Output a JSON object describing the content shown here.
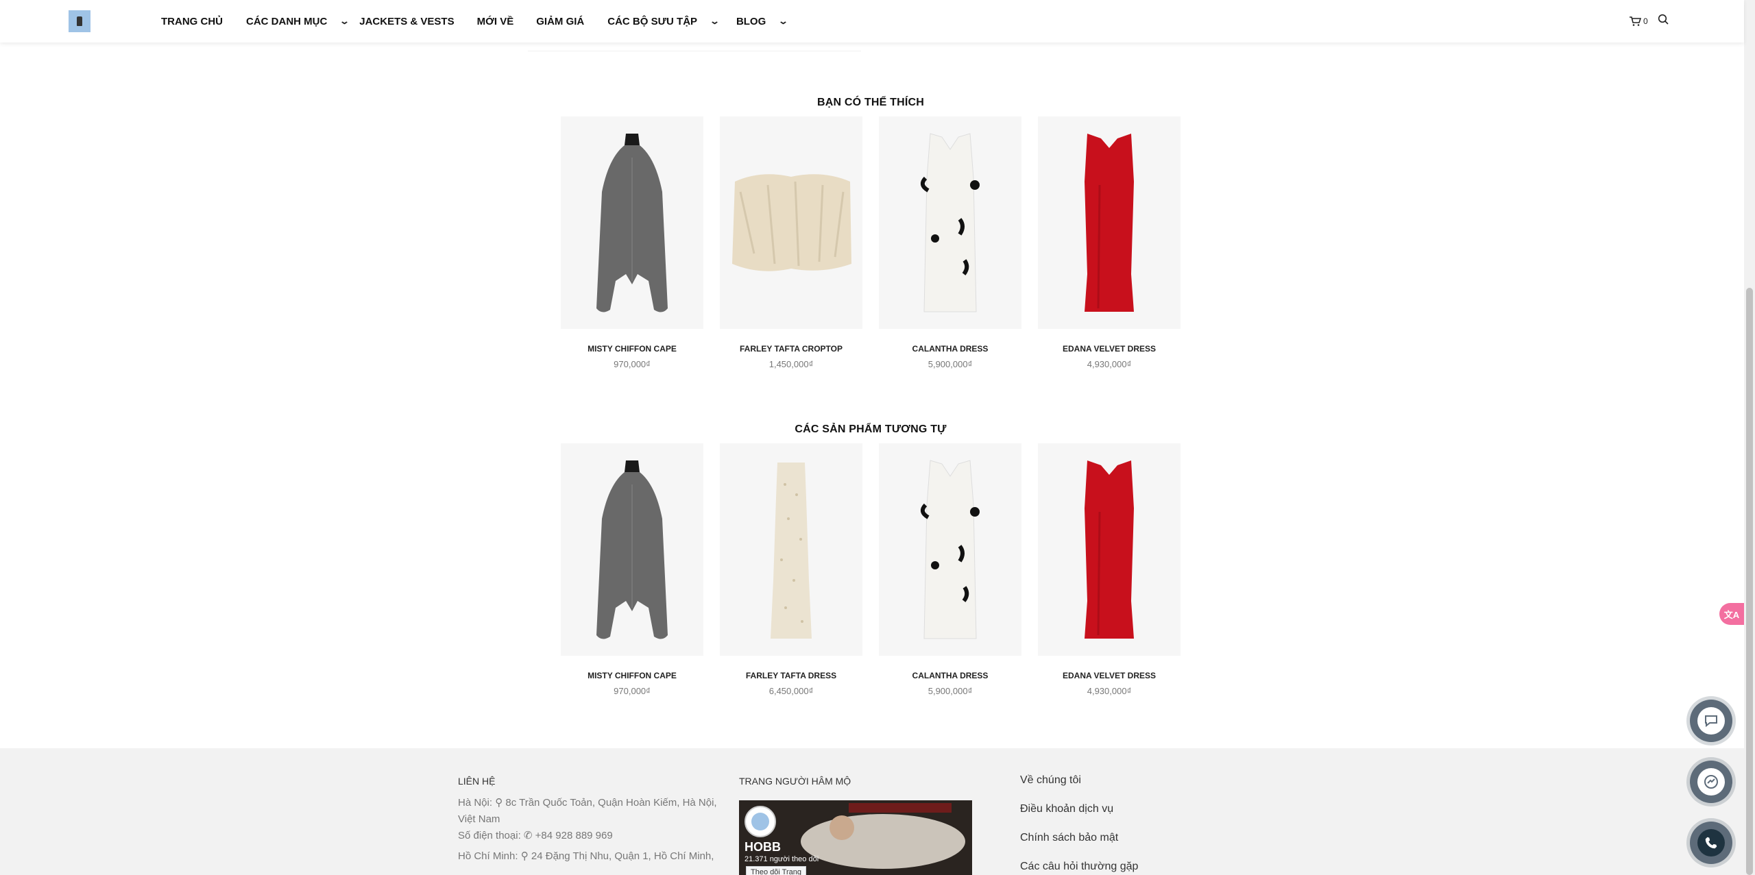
{
  "header": {
    "nav": [
      {
        "label": "TRANG CHỦ",
        "has_dropdown": false
      },
      {
        "label": "CÁC DANH MỤC",
        "has_dropdown": true
      },
      {
        "label": "JACKETS & VESTS",
        "has_dropdown": false
      },
      {
        "label": "MỚI VỀ",
        "has_dropdown": false
      },
      {
        "label": "GIẢM GIÁ",
        "has_dropdown": false
      },
      {
        "label": "CÁC BỘ SƯU TẬP",
        "has_dropdown": true
      },
      {
        "label": "BLOG",
        "has_dropdown": true
      }
    ],
    "cart_count": "0",
    "icons": {
      "cart": "cart-icon",
      "search": "search-icon",
      "dropdown": "chevron-down-icon"
    }
  },
  "sections": {
    "you_may_like": {
      "title": "BẠN CÓ THỂ THÍCH",
      "products": [
        {
          "name": "MISTY CHIFFON CAPE",
          "price": "970,000₫",
          "image": "sheer-black-cape"
        },
        {
          "name": "FARLEY TAFTA CROPTOP",
          "price": "1,450,000₫",
          "image": "feather-croptop"
        },
        {
          "name": "CALANTHA DRESS",
          "price": "5,900,000₫",
          "image": "white-dress-black-flowers"
        },
        {
          "name": "EDANA VELVET DRESS",
          "price": "4,930,000₫",
          "image": "red-velvet-dress"
        }
      ]
    },
    "similar_products": {
      "title": "CÁC SẢN PHẨM TƯƠNG TỰ",
      "products": [
        {
          "name": "MISTY CHIFFON CAPE",
          "price": "970,000₫",
          "image": "sheer-black-cape"
        },
        {
          "name": "FARLEY TAFTA DRESS",
          "price": "6,450,000₫",
          "image": "embellished-ivory-dress"
        },
        {
          "name": "CALANTHA DRESS",
          "price": "5,900,000₫",
          "image": "white-dress-black-flowers"
        },
        {
          "name": "EDANA VELVET DRESS",
          "price": "4,930,000₫",
          "image": "red-velvet-dress"
        }
      ]
    }
  },
  "footer": {
    "contact_heading": "LIÊN HỆ",
    "hanoi_label": "Hà Nội:",
    "hanoi_address": "8c Trần Quốc Toản, Quận Hoàn Kiếm, Hà Nội, Việt Nam",
    "phone_label": "Số điện thoại:",
    "phone": "+84 928 889 969",
    "hcm_label": "Hồ Chí Minh:",
    "hcm_address": "24 Đặng Thị Nhu, Quận 1, Hồ Chí Minh,",
    "fanpage_heading": "TRANG NGƯỜI HÂM MỘ",
    "fanpage_name": "HOBB",
    "fanpage_followers": "21.371 người theo dõi",
    "fanpage_follow_btn": "Theo dõi Trang",
    "links": [
      "Về chúng tôi",
      "Điều khoản dịch vụ",
      "Chính sách bảo mật",
      "Các câu hỏi thường gặp"
    ]
  },
  "colors": {
    "accent_pink": "#f36fa0",
    "float_button": "#5d6b79",
    "dress_red": "#c8101c"
  }
}
